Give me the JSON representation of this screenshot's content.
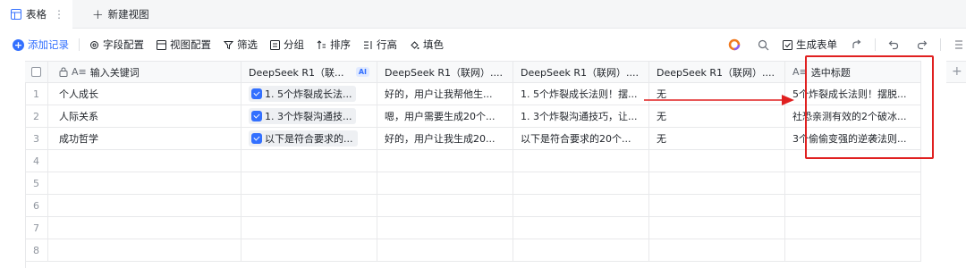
{
  "tabs": {
    "active_label": "表格",
    "more_label": "⋮",
    "new_view_label": "新建视图"
  },
  "toolbar": {
    "add_record": "添加记录",
    "field_config": "字段配置",
    "view_config": "视图配置",
    "filter": "筛选",
    "group": "分组",
    "sort": "排序",
    "row_height": "行高",
    "fill_color": "填色",
    "generate_form": "生成表单"
  },
  "columns": {
    "keyword": "输入关键词",
    "ds1": "DeepSeek R1（联...",
    "ds1_badge": "AI",
    "ds2": "DeepSeek R1（联网）....",
    "ds3": "DeepSeek R1（联网）....",
    "ds4": "DeepSeek R1（联网）....",
    "title": "选中标题"
  },
  "rows": [
    {
      "index": "1",
      "keyword": "个人成长",
      "ds1": "1. 5个炸裂成长法...",
      "ds2": "好的，用户让我帮他生...",
      "ds3": "1. 5个炸裂成长法则！摆...",
      "ds4": "无",
      "title": "5个炸裂成长法则！摆脱..."
    },
    {
      "index": "2",
      "keyword": "人际关系",
      "ds1": "1. 3个炸裂沟通技...",
      "ds2": "嗯，用户需要生成20个...",
      "ds3": "1. 3个炸裂沟通技巧，让...",
      "ds4": "无",
      "title": "社恐亲测有效的2个破冰..."
    },
    {
      "index": "3",
      "keyword": "成功哲学",
      "ds1": "以下是符合要求的...",
      "ds2": "好的，用户让我生成20...",
      "ds3": "以下是符合要求的20个...",
      "ds4": "无",
      "title": "3个偷偷变强的逆袭法则..."
    },
    {
      "index": "4"
    },
    {
      "index": "5"
    },
    {
      "index": "6"
    },
    {
      "index": "7"
    },
    {
      "index": "8"
    }
  ],
  "colors": {
    "accent": "#3370ff",
    "annotation_red": "#e02020"
  }
}
